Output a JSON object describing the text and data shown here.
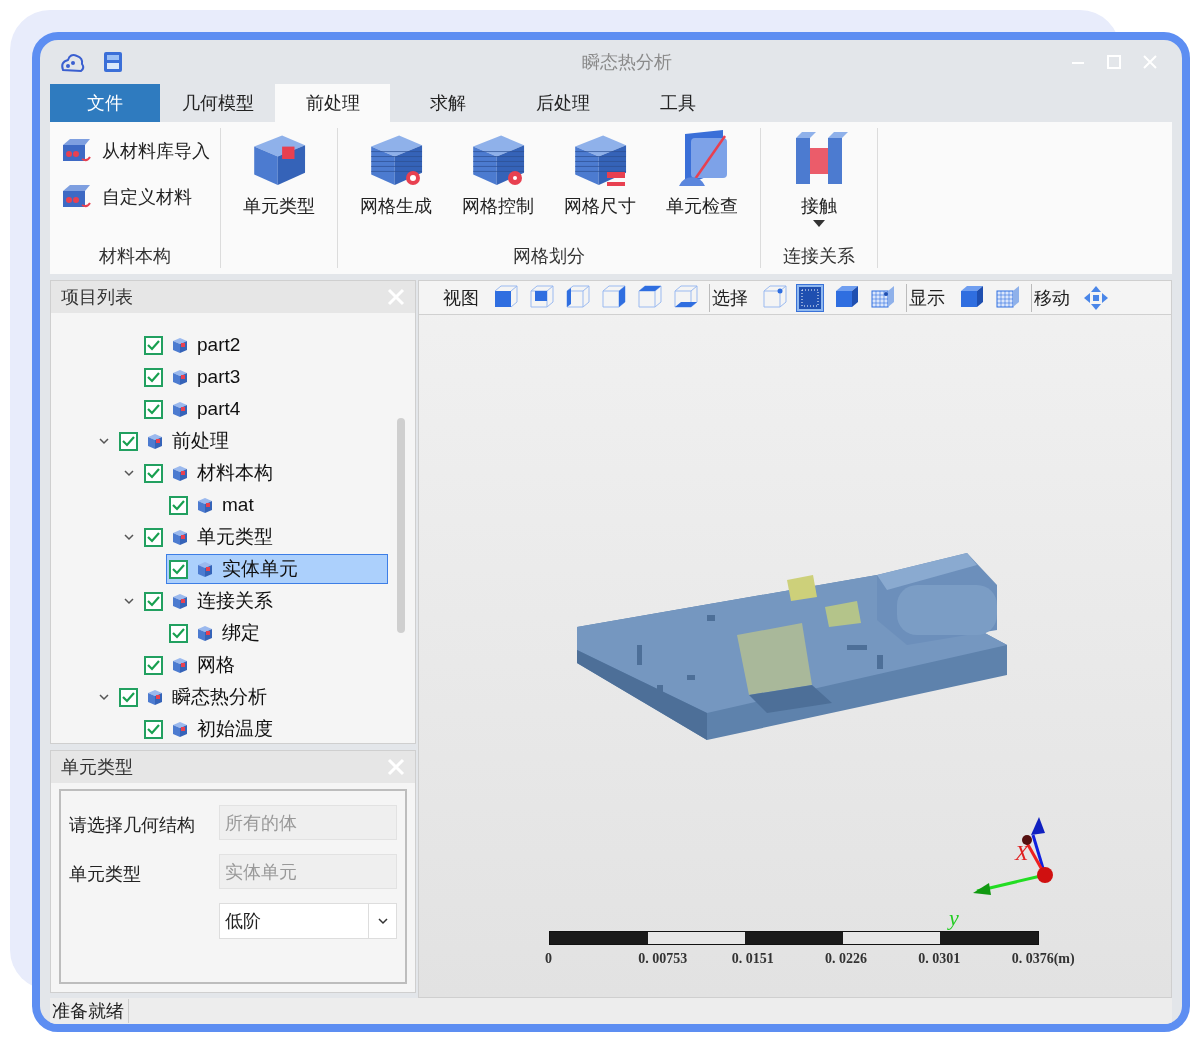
{
  "window": {
    "title": "瞬态热分析"
  },
  "tabs": [
    {
      "label": "文件",
      "kind": "file",
      "selected": false
    },
    {
      "label": "几何模型",
      "kind": "tab",
      "selected": false
    },
    {
      "label": "前处理",
      "kind": "tab",
      "selected": true
    },
    {
      "label": "求解",
      "kind": "tab",
      "selected": false
    },
    {
      "label": "后处理",
      "kind": "tab",
      "selected": false
    },
    {
      "label": "工具",
      "kind": "tab",
      "selected": false
    }
  ],
  "ribbon": {
    "groups": [
      {
        "label": "材料本构",
        "kind": "list",
        "buttons": [
          {
            "label": "从材料库导入"
          },
          {
            "label": "自定义材料"
          }
        ]
      },
      {
        "kind": "large",
        "buttons": [
          {
            "label": "单元类型"
          }
        ]
      },
      {
        "label": "网格划分",
        "kind": "large",
        "buttons": [
          {
            "label": "网格生成"
          },
          {
            "label": "网格控制"
          },
          {
            "label": "网格尺寸"
          },
          {
            "label": "单元检查"
          }
        ]
      },
      {
        "label": "连接关系",
        "kind": "large",
        "buttons": [
          {
            "label": "接触",
            "dropdown": true
          }
        ]
      }
    ]
  },
  "project_panel": {
    "title": "项目列表",
    "tree": {
      "continued_items": [
        {
          "label": "part2",
          "checked": true,
          "selected": false
        },
        {
          "label": "part3",
          "checked": true,
          "selected": false
        },
        {
          "label": "part4",
          "checked": true,
          "selected": false
        }
      ],
      "items": [
        {
          "label": "前处理",
          "checked": true,
          "selected": false,
          "expanded": true,
          "children": [
            {
              "label": "材料本构",
              "checked": true,
              "selected": false,
              "expanded": true,
              "children": [
                {
                  "label": "mat",
                  "checked": true,
                  "selected": false
                }
              ]
            },
            {
              "label": "单元类型",
              "checked": true,
              "selected": false,
              "expanded": true,
              "children": [
                {
                  "label": "实体单元",
                  "checked": true,
                  "selected": true
                }
              ]
            },
            {
              "label": "连接关系",
              "checked": true,
              "selected": false,
              "expanded": true,
              "children": [
                {
                  "label": "绑定",
                  "checked": true,
                  "selected": false
                }
              ]
            },
            {
              "label": "网格",
              "checked": true,
              "selected": false
            }
          ]
        },
        {
          "label": "瞬态热分析",
          "checked": true,
          "selected": false,
          "expanded": true,
          "children": [
            {
              "label": "初始温度",
              "checked": true,
              "selected": false
            }
          ]
        }
      ]
    }
  },
  "property_panel": {
    "title": "单元类型",
    "fields": [
      {
        "kind": "readonly",
        "label": "请选择几何结构",
        "value": "所有的体",
        "disabled": true
      },
      {
        "kind": "readonly",
        "label": "单元类型",
        "value": "实体单元",
        "disabled": true
      },
      {
        "kind": "dropdown",
        "value": "低阶"
      }
    ]
  },
  "view_toolbar": {
    "groups": [
      {
        "label": "视图",
        "tools": [
          {
            "selected": false
          },
          {
            "selected": false
          },
          {
            "selected": false
          },
          {
            "selected": false
          },
          {
            "selected": false
          },
          {
            "selected": false
          }
        ]
      },
      {
        "label": "选择",
        "tools": [
          {
            "selected": false
          },
          {
            "selected": true
          },
          {
            "selected": false
          },
          {
            "selected": false
          }
        ]
      },
      {
        "label": "显示",
        "tools": [
          {
            "selected": false
          },
          {
            "selected": false
          }
        ]
      },
      {
        "label": "移动",
        "tools": [
          {
            "selected": false
          }
        ]
      }
    ]
  },
  "viewport": {
    "axes": {
      "x_label": "X",
      "y_label": "y"
    },
    "scale_bar": {
      "labels": [
        "0",
        "0. 00753",
        "0. 0151",
        "0. 0226",
        "0. 0301",
        "0. 0376(m)"
      ]
    }
  },
  "status_bar": {
    "text": "准备就绪"
  }
}
